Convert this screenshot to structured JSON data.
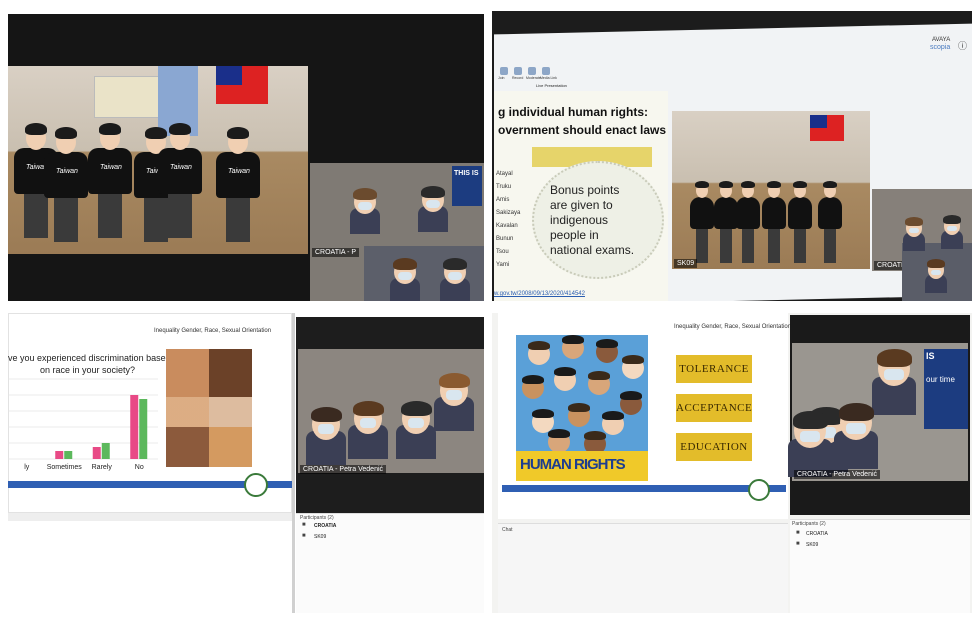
{
  "panel_tl": {
    "shirt_text": "Taiwan",
    "croatia_label": "CROATIA - P",
    "this_is": "THIS IS"
  },
  "panel_tr": {
    "toolbar": [
      "Join",
      "Record",
      "Moderate",
      "Media Link"
    ],
    "toolbar_sub": "Live Presentation",
    "brand_1": "AVAYA",
    "brand_2": "scopia",
    "slide_title_1": "g individual human rights:",
    "slide_title_2": "overnment should enact laws",
    "cloud_text": "Bonus points are given to indigenous people in national exams.",
    "tribes": [
      "Atayal",
      "Truku",
      "Amis",
      "Sakizaya",
      "Kavalan",
      "Bunun",
      "Tsou",
      "Yami"
    ],
    "link": "w.gov.tw/2008/09/13/2020/414542",
    "sk_label": "SK09",
    "croatia_label": "CROATIA"
  },
  "panel_bl": {
    "slide_header": "Inequality Gender, Race, Sexual Orientation",
    "question_1": "ve you experienced discrimination based",
    "question_2": "on race in your society?",
    "chart_data": {
      "type": "bar",
      "categories": [
        "ly",
        "Sometimes",
        "Rarely",
        "No"
      ],
      "series": [
        {
          "color": "#e84a86",
          "values": [
            0,
            2,
            3,
            16
          ]
        },
        {
          "color": "#5cb85c",
          "values": [
            0,
            2,
            4,
            15
          ]
        }
      ],
      "ylim": [
        0,
        20
      ]
    },
    "video_label": "CROATIA - Petra Vedenić",
    "participants_header": "Participants (2)",
    "participants": [
      "CROATIA",
      "SK09"
    ]
  },
  "panel_br": {
    "slide_header": "Inequality Gender, Race, Sexual Orientation",
    "human_rights": "HUMAN RIGHTS",
    "words": [
      "TOLERANCE",
      "ACCEPTANCE",
      "EDUCATION"
    ],
    "video_label": "CROATIA - Petra Vedenić",
    "chat_label": "Chat",
    "participants_header": "Participants (2)",
    "participants": [
      "CROATIA",
      "SK09"
    ],
    "sign_1": "IS",
    "sign_2": "our time"
  },
  "colors": {
    "accent_blue": "#2f5fb3",
    "pink_bar": "#e84a86",
    "green_bar": "#5cb85c",
    "word_card": "#e3bc2a"
  }
}
